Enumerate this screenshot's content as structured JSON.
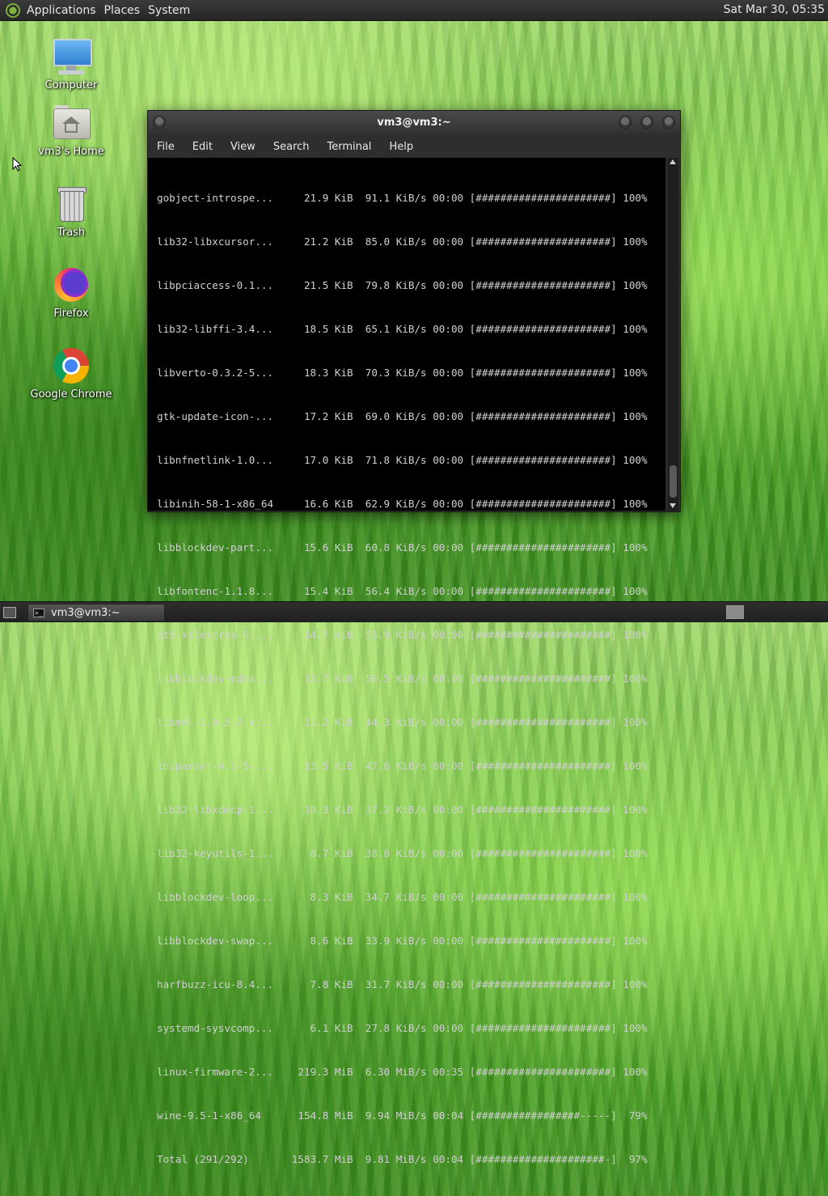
{
  "top_panel": {
    "menus": [
      "Applications",
      "Places",
      "System"
    ],
    "clock": "Sat Mar 30, 05:35"
  },
  "desktop": {
    "icons": [
      {
        "label": "Computer",
        "icon": "computer-icon"
      },
      {
        "label": "vm3's Home",
        "icon": "home-folder-icon"
      },
      {
        "label": "Trash",
        "icon": "trash-icon"
      },
      {
        "label": "Firefox",
        "icon": "firefox-icon"
      },
      {
        "label": "Google Chrome",
        "icon": "chrome-icon"
      }
    ]
  },
  "terminal": {
    "title": "vm3@vm3:~",
    "menu": [
      "File",
      "Edit",
      "View",
      "Search",
      "Terminal",
      "Help"
    ],
    "lines": [
      "gobject-introspe...     21.9 KiB  91.1 KiB/s 00:00 [######################] 100%",
      "lib32-libxcursor...     21.2 KiB  85.0 KiB/s 00:00 [######################] 100%",
      "libpciaccess-0.1...     21.5 KiB  79.8 KiB/s 00:00 [######################] 100%",
      "lib32-libffi-3.4...     18.5 KiB  65.1 KiB/s 00:00 [######################] 100%",
      "libverto-0.3.2-5...     18.3 KiB  70.3 KiB/s 00:00 [######################] 100%",
      "gtk-update-icon-...     17.2 KiB  69.0 KiB/s 00:00 [######################] 100%",
      "libnfnetlink-1.0...     17.0 KiB  71.8 KiB/s 00:00 [######################] 100%",
      "libinih-58-1-x86_64     16.6 KiB  62.9 KiB/s 00:00 [######################] 100%",
      "libblockdev-part...     15.6 KiB  60.8 KiB/s 00:00 [######################] 100%",
      "libfontenc-1.1.8...     15.4 KiB  56.4 KiB/s 00:00 [######################] 100%",
      "qt5-x11extras-5....     14.7 KiB  55.9 KiB/s 00:00 [######################] 100%",
      "libblockdev-mdra...     13.7 KiB  56.5 KiB/s 00:00 [######################] 100%",
      "libmnl-1.0.5-2-x...     11.2 KiB  44.3 KiB/s 00:00 [######################] 100%",
      "iniparser-4.1-5-...     13.5 KiB  47.6 KiB/s 00:00 [######################] 100%",
      "lib32-libxdmcp-1...     10.3 KiB  37.2 KiB/s 00:00 [######################] 100%",
      "lib32-keyutils-1...      8.7 KiB  38.8 KiB/s 00:00 [######################] 100%",
      "libblockdev-loop...      8.3 KiB  34.7 KiB/s 00:00 [######################] 100%",
      "libblockdev-swap...      8.6 KiB  33.9 KiB/s 00:00 [######################] 100%",
      "harfbuzz-icu-8.4...      7.8 KiB  31.7 KiB/s 00:00 [######################] 100%",
      "systemd-sysvcomp...      6.1 KiB  27.8 KiB/s 00:00 [######################] 100%",
      "linux-firmware-2...    219.3 MiB  6.30 MiB/s 00:35 [######################] 100%",
      "wine-9.5-1-x86_64      154.8 MiB  9.94 MiB/s 00:04 [#################-----]  79%",
      "Total (291/292)       1583.7 MiB  9.81 MiB/s 00:04 [#####################-]  97%"
    ]
  },
  "taskbar": {
    "window_label": "vm3@vm3:~"
  }
}
